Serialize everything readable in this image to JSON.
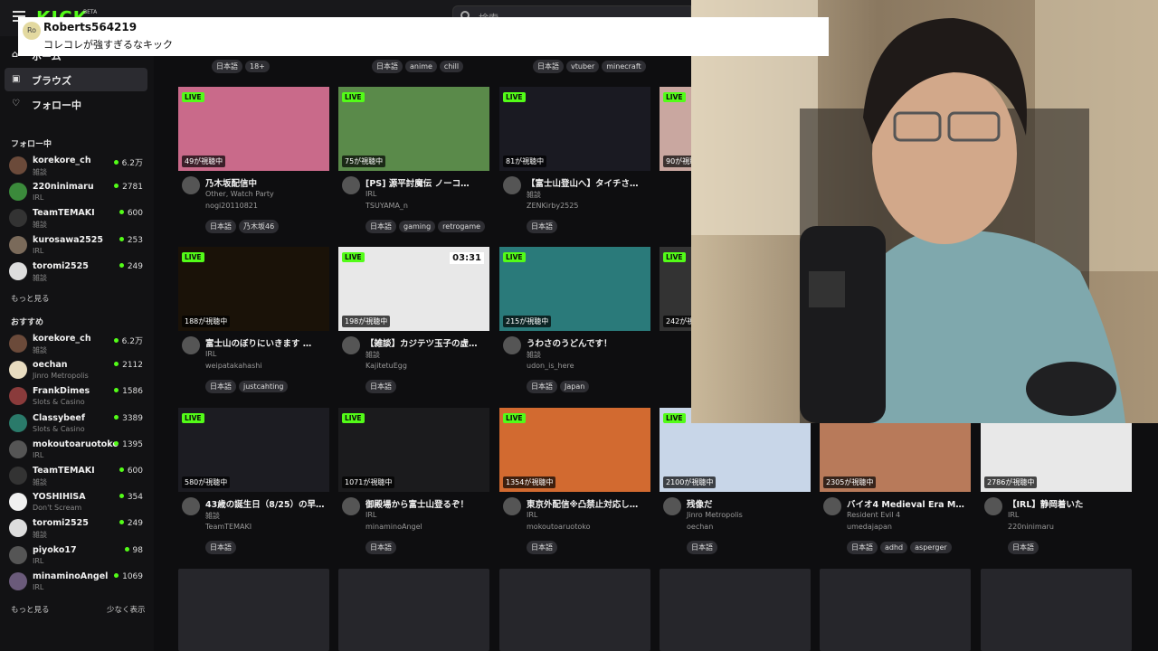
{
  "topbar": {
    "logo": "KICK",
    "logo_beta": "BETA",
    "search_placeholder": "検索"
  },
  "comment": {
    "avatar": "Ro",
    "user": "Roberts564219",
    "text": "コレコレが強すぎるなキック"
  },
  "sidebar": {
    "nav": [
      {
        "icon": "home-icon",
        "label": "ホーム"
      },
      {
        "icon": "browse-icon",
        "label": "ブラウズ"
      },
      {
        "icon": "heart-icon",
        "label": "フォロー中"
      }
    ],
    "following_title": "フォロー中",
    "following": [
      {
        "name": "korekore_ch",
        "cat": "雑談",
        "viewers": "6.2万"
      },
      {
        "name": "220ninimaru",
        "cat": "IRL",
        "viewers": "2781"
      },
      {
        "name": "TeamTEMAKI",
        "cat": "雑談",
        "viewers": "600"
      },
      {
        "name": "kurosawa2525",
        "cat": "IRL",
        "viewers": "253"
      },
      {
        "name": "toromi2525",
        "cat": "雑談",
        "viewers": "249"
      }
    ],
    "following_more": "もっと見る",
    "recommended_title": "おすすめ",
    "recommended": [
      {
        "name": "korekore_ch",
        "cat": "雑談",
        "viewers": "6.2万"
      },
      {
        "name": "oechan",
        "cat": "Jinro Metropolis",
        "viewers": "2112"
      },
      {
        "name": "FrankDimes",
        "cat": "Slots & Casino",
        "viewers": "1586"
      },
      {
        "name": "Classybeef",
        "cat": "Slots & Casino",
        "viewers": "3389"
      },
      {
        "name": "mokoutoaruotoko",
        "cat": "IRL",
        "viewers": "1395"
      },
      {
        "name": "TeamTEMAKI",
        "cat": "雑談",
        "viewers": "600"
      },
      {
        "name": "YOSHIHISA",
        "cat": "Don't Scream",
        "viewers": "354"
      },
      {
        "name": "toromi2525",
        "cat": "雑談",
        "viewers": "249"
      },
      {
        "name": "piyoko17",
        "cat": "IRL",
        "viewers": "98"
      },
      {
        "name": "minaminoAngel",
        "cat": "IRL",
        "viewers": "1069"
      }
    ],
    "recommended_more": "もっと見る",
    "recommended_less": "少なく表示"
  },
  "top_tags": [
    [
      "日本語",
      "18+"
    ],
    [
      "日本語",
      "anime",
      "chill"
    ],
    [
      "日本語",
      "vtuber",
      "minecraft"
    ]
  ],
  "live_label": "LIVE",
  "rows": [
    [
      {
        "viewers": "49が視聴中",
        "title": "乃木坂配信中",
        "cat": "Other, Watch Party",
        "user": "nogi20110821",
        "tags": [
          "日本語",
          "乃木坂46"
        ]
      },
      {
        "viewers": "75が視聴中",
        "title": "[PS] 源平討魔伝 ノーコ…",
        "cat": "IRL",
        "user": "TSUYAMA_n",
        "tags": [
          "日本語",
          "gaming",
          "retrogame"
        ]
      },
      {
        "viewers": "81が視聴中",
        "title": "【富士山登山へ】タイチさ…",
        "cat": "雑談",
        "user": "ZENKirby2525",
        "tags": [
          "日本語"
        ]
      },
      {
        "viewers": "90が視聴中",
        "title": "",
        "cat": "",
        "user": "",
        "tags": []
      }
    ],
    [
      {
        "viewers": "188が視聴中",
        "title": "富士山のぼりにいきます …",
        "cat": "IRL",
        "user": "weipatakahashi",
        "tags": [
          "日本語",
          "justcahting"
        ]
      },
      {
        "viewers": "198が視聴中",
        "title": "【雑談】カジテツ玉子の虚…",
        "cat": "雑談",
        "user": "KajitetuEgg",
        "tags": [
          "日本語"
        ]
      },
      {
        "viewers": "215が視聴中",
        "title": "うわさのうどんです！",
        "cat": "雑談",
        "user": "udon_is_here",
        "tags": [
          "日本語",
          "Japan"
        ]
      },
      {
        "viewers": "242が視",
        "title": "",
        "cat": "",
        "user": "",
        "tags": []
      }
    ],
    [
      {
        "viewers": "580が視聴中",
        "title": "43歳の誕生日（8/25）の早…",
        "cat": "雑談",
        "user": "TeamTEMAKI",
        "tags": [
          "日本語"
        ]
      },
      {
        "viewers": "1071が視聴中",
        "title": "御殿場から富士山登るぞ！",
        "cat": "IRL",
        "user": "minaminoAngel",
        "tags": [
          "日本語"
        ]
      },
      {
        "viewers": "1354が視聴中",
        "title": "東京外配信※凸禁止対応し…",
        "cat": "IRL",
        "user": "mokoutoaruotoko",
        "tags": [
          "日本語"
        ]
      },
      {
        "viewers": "2100が視聴中",
        "title": "残像だ",
        "cat": "Jinro Metropolis",
        "user": "oechan",
        "tags": [
          "日本語"
        ]
      },
      {
        "viewers": "2305が視聴中",
        "title": "バイオ4 Medieval Era MO…",
        "cat": "Resident Evil 4",
        "user": "umedajapan",
        "tags": [
          "日本語",
          "adhd",
          "asperger"
        ]
      },
      {
        "viewers": "2786が視聴中",
        "title": "【IRL】静岡着いた",
        "cat": "IRL",
        "user": "220ninimaru",
        "tags": [
          "日本語"
        ]
      }
    ]
  ],
  "thumb_overlay": {
    "timer": "03:31"
  },
  "colors": {
    "accent": "#53fc18",
    "background": "#0e0e10",
    "sidebar": "#121214"
  }
}
